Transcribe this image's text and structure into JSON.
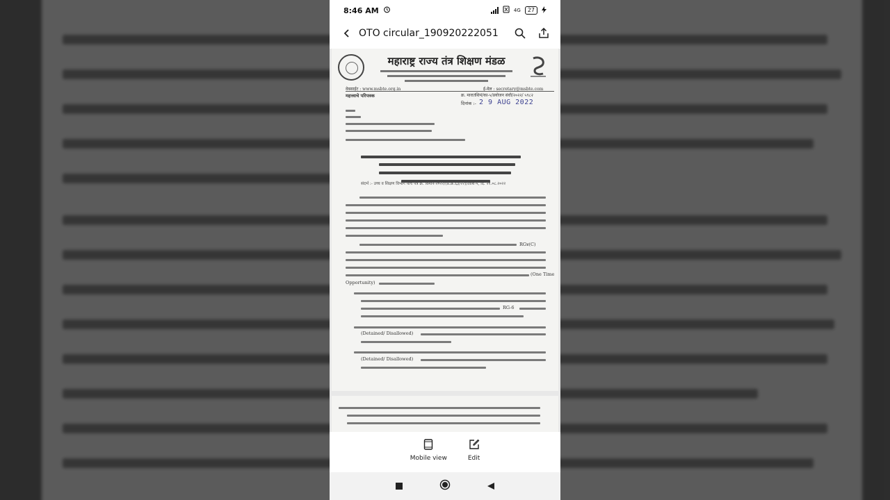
{
  "status_bar": {
    "time": "8:46 AM",
    "alarm_icon": "alarm-icon",
    "network": "4G",
    "battery": "27"
  },
  "app_bar": {
    "title": "OTO circular_190920222051",
    "back_icon": "back-arrow-icon",
    "search_icon": "search-icon",
    "share_icon": "share-icon"
  },
  "document": {
    "org_title": "महाराष्ट्र राज्य तंत्र शिक्षण मंडळ",
    "website": "वेबसाईट : www.msbte.org.in",
    "email": "ई-मेल : secretary@msbte.com",
    "circular_label": "महत्त्वाचे परिपत्रक",
    "ref_no": "क्र. मारातंशिमं/का-५/प्रयोजन संधी/२०२२/ ५९८२",
    "date_label": "दिनांक :-",
    "date_stamp": "2 9 AUG 2022",
    "reference": "संदर्भ :- उच्च व शिक्षण विभाग यांचे पत्र क्र. विमनि-२०२२/(प्र.क्र.६३/२२)/तांशि-५, दि. २१.०८.२०२२",
    "one_time": "(One Time",
    "opportunity": "Opportunity)",
    "detained": "(Detained/ Disallowed)",
    "detained2": "(Detained/ Disallowed)",
    "rg4": "RG४(C)",
    "rg6": "RG-6"
  },
  "bottom_toolbar": {
    "mobile_view_label": "Mobile view",
    "edit_label": "Edit"
  }
}
